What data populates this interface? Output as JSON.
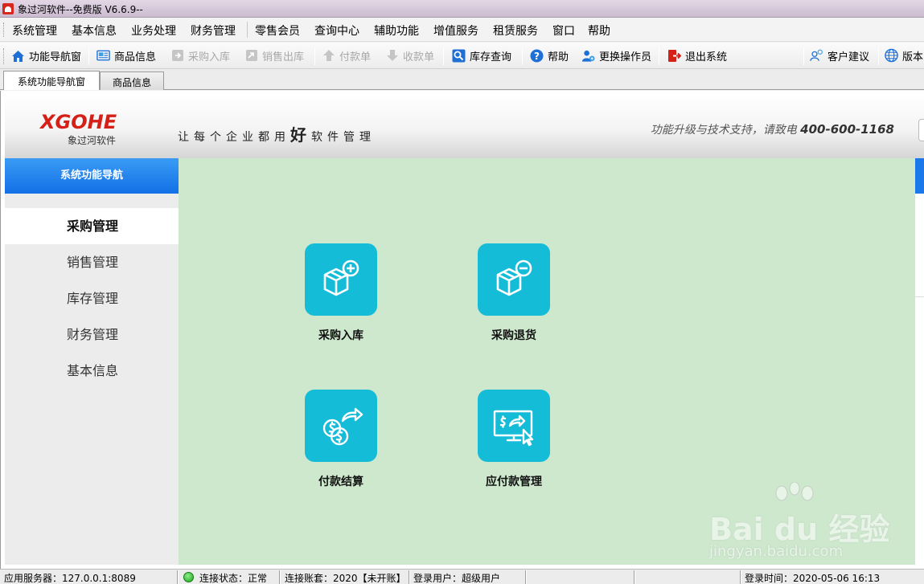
{
  "window": {
    "title": "象过河软件--免费版 V6.6.9--"
  },
  "menu": [
    "系统管理",
    "基本信息",
    "业务处理",
    "财务管理",
    "零售会员",
    "查询中心",
    "辅助功能",
    "增值服务",
    "租赁服务",
    "窗口",
    "帮助"
  ],
  "toolbar": {
    "nav_window": "功能导航窗",
    "product_info": "商品信息",
    "purchase_in": "采购入库",
    "sales_out": "销售出库",
    "payment": "付款单",
    "receipt": "收款单",
    "stock_query": "库存查询",
    "help": "帮助",
    "switch_operator": "更换操作员",
    "exit": "退出系统",
    "feedback": "客户建议",
    "version": "版本"
  },
  "tabs": [
    "系统功能导航窗",
    "商品信息"
  ],
  "banner": {
    "logo": "XGOHE",
    "logo_sub": "象过河软件",
    "slogan_pre": "让每个企业都用",
    "slogan_big": "好",
    "slogan_post": "软件管理",
    "support_text": "功能升级与技术支持，请致电",
    "phone": "400-600-1168"
  },
  "sidebar": {
    "header": "系统功能导航",
    "items": [
      "采购管理",
      "销售管理",
      "库存管理",
      "财务管理",
      "基本信息"
    ],
    "active": "采购管理"
  },
  "functions": [
    {
      "label": "采购入库",
      "icon": "box-plus-icon"
    },
    {
      "label": "采购退货",
      "icon": "box-minus-icon"
    },
    {
      "label": "付款结算",
      "icon": "coins-transfer-icon"
    },
    {
      "label": "应付款管理",
      "icon": "monitor-payment-icon"
    }
  ],
  "watermark": {
    "text": "Bai du 经验",
    "url": "jingyan.baidu.com"
  },
  "status": {
    "server": "应用服务器：127.0.0.1:8089",
    "connection": "连接状态：正常",
    "account": "连接账套：2020【未开账】",
    "user": "登录用户：超级用户",
    "login_time": "登录时间：2020-05-06 16:13"
  },
  "colors": {
    "accent_blue": "#1a78e8",
    "tile_cyan": "#15bcd8",
    "content_green": "#cde8cd",
    "logo_red": "#d42016"
  }
}
